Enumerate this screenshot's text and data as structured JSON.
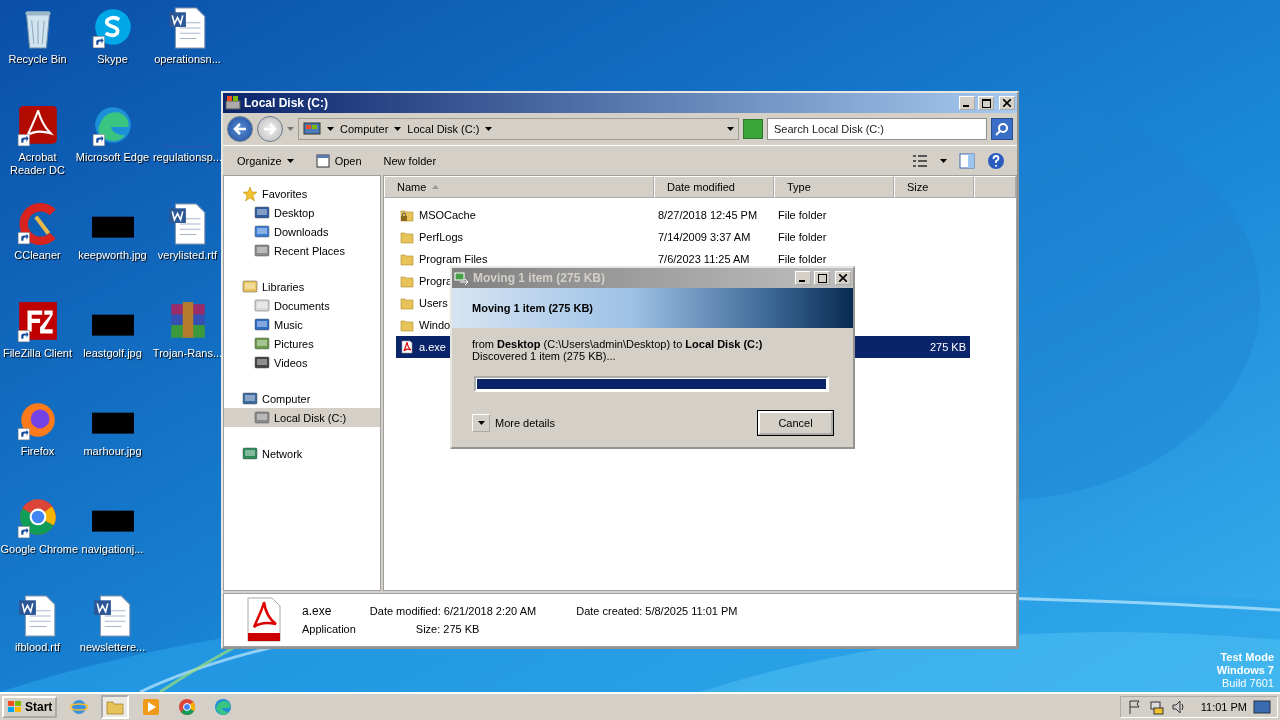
{
  "desktop_icons": [
    {
      "label": "Recycle Bin",
      "kind": "recycle",
      "shortcut": false
    },
    {
      "label": "Acrobat Reader DC",
      "kind": "acrobat",
      "shortcut": true
    },
    {
      "label": "CCleaner",
      "kind": "ccleaner",
      "shortcut": true
    },
    {
      "label": "FileZilla Client",
      "kind": "filezilla",
      "shortcut": true
    },
    {
      "label": "Firefox",
      "kind": "firefox",
      "shortcut": true
    },
    {
      "label": "Google Chrome",
      "kind": "chrome",
      "shortcut": true
    },
    {
      "label": "ifblood.rtf",
      "kind": "word",
      "shortcut": false
    },
    {
      "label": "Skype",
      "kind": "skype",
      "shortcut": true
    },
    {
      "label": "Microsoft Edge",
      "kind": "edge",
      "shortcut": true
    },
    {
      "label": "keepworth.jpg",
      "shortcut": false
    },
    {
      "label": "leastgolf.jpg",
      "shortcut": false
    },
    {
      "label": "marhour.jpg",
      "shortcut": false
    },
    {
      "label": "navigationj...",
      "shortcut": false
    },
    {
      "label": "newslettere...",
      "kind": "word",
      "shortcut": false
    },
    {
      "label": "operationsn...",
      "kind": "word",
      "shortcut": false
    },
    {
      "label": "regulationsp...",
      "kind": "blank",
      "shortcut": false
    },
    {
      "label": "verylisted.rtf",
      "kind": "word",
      "shortcut": false
    },
    {
      "label": "Trojan-Rans...",
      "kind": "winrar",
      "shortcut": false
    }
  ],
  "explorer": {
    "title": "Local Disk (C:)",
    "breadcrumbs": [
      "Computer",
      "Local Disk (C:)"
    ],
    "search": {
      "placeholder": "Search Local Disk (C:)"
    },
    "toolbar": [
      {
        "label": "Organize",
        "kind": "menu"
      },
      {
        "label": "Open",
        "kind": "open"
      },
      {
        "label": "New folder",
        "kind": "plain"
      }
    ],
    "nav": [
      {
        "label": "Favorites",
        "kind": "star",
        "selected": false,
        "children": [
          {
            "label": "Desktop",
            "kind": "desktop",
            "selected": false
          },
          {
            "label": "Downloads",
            "kind": "downloads",
            "selected": false
          },
          {
            "label": "Recent Places",
            "kind": "recent",
            "selected": false
          }
        ]
      },
      {
        "label": "Libraries",
        "kind": "library",
        "selected": false,
        "children": [
          {
            "label": "Documents",
            "kind": "documents",
            "selected": false
          },
          {
            "label": "Music",
            "kind": "music",
            "selected": false
          },
          {
            "label": "Pictures",
            "kind": "pictures",
            "selected": false
          },
          {
            "label": "Videos",
            "kind": "videos",
            "selected": false
          }
        ]
      },
      {
        "label": "Computer",
        "kind": "computer",
        "selected": false,
        "children": [
          {
            "label": "Local Disk (C:)",
            "kind": "disk",
            "selected": true
          }
        ]
      },
      {
        "label": "Network",
        "kind": "network",
        "selected": false
      }
    ],
    "columns": [
      "Name",
      "Date modified",
      "Type",
      "Size"
    ],
    "files": [
      {
        "name": "MSOCache",
        "date": "8/27/2018 12:45 PM",
        "type": "File folder",
        "kind": "locked-folder",
        "selected": false
      },
      {
        "name": "PerfLogs",
        "date": "7/14/2009 3:37 AM",
        "type": "File folder",
        "kind": "folder",
        "selected": false
      },
      {
        "name": "Program Files",
        "date": "7/6/2023 11:25 AM",
        "type": "File folder",
        "kind": "folder",
        "selected": false
      },
      {
        "name": "Progra",
        "kind": "folder",
        "selected": false
      },
      {
        "name": "Users",
        "kind": "folder",
        "selected": false
      },
      {
        "name": "Windo",
        "kind": "folder",
        "selected": false
      },
      {
        "name": "a.exe",
        "size": "275 KB",
        "kind": "pdf",
        "selected": true
      }
    ],
    "details": {
      "name": "a.exe",
      "type": "Application",
      "fields": [
        {
          "label": "Date modified:",
          "value": "6/21/2018 2:20 AM"
        },
        {
          "label": "Date created:",
          "value": "5/8/2025 11:01 PM"
        },
        {
          "label": "Size:",
          "value": "275 KB"
        }
      ]
    }
  },
  "dialog": {
    "title": "Moving 1 item (275 KB)",
    "heading": "Moving 1 item (275 KB)",
    "from": "from **Desktop** (C:\\Users\\admin\\Desktop) to **Local Disk (C:)**",
    "status": "Discovered 1 item (275 KB)...",
    "level": 1,
    "more": "More details",
    "cancel": "Cancel"
  },
  "watermark": [
    "Test Mode",
    "Windows 7",
    "Build 7601"
  ],
  "taskbar": {
    "start": "Start",
    "apps": [
      {
        "kind": "ie",
        "selected": false
      },
      {
        "kind": "explorer",
        "selected": true
      },
      {
        "kind": "media",
        "selected": false
      },
      {
        "kind": "chrome",
        "selected": false
      },
      {
        "kind": "edge",
        "selected": false
      }
    ],
    "tray": [
      {
        "kind": "flag"
      },
      {
        "kind": "network"
      },
      {
        "kind": "volume"
      }
    ],
    "time": "11:01 PM"
  }
}
